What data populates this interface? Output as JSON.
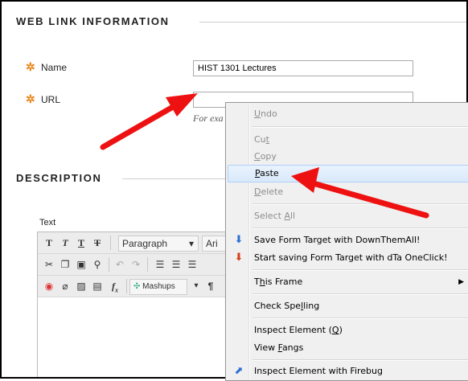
{
  "sections": {
    "web_link_info": "WEB LINK INFORMATION",
    "description": "DESCRIPTION"
  },
  "form": {
    "name_label": "Name",
    "name_value": "HIST 1301 Lectures",
    "url_label": "URL",
    "url_value": "",
    "url_hint": "For exa",
    "text_label": "Text"
  },
  "editor": {
    "paragraph": "Paragraph",
    "font": "Ari",
    "mashups": "Mashups"
  },
  "context_menu": {
    "items": [
      {
        "label_pre": "",
        "mnemonic": "U",
        "label_post": "ndo",
        "enabled": false
      },
      {
        "label_pre": "Cu",
        "mnemonic": "t",
        "label_post": "",
        "enabled": false
      },
      {
        "label_pre": "",
        "mnemonic": "C",
        "label_post": "opy",
        "enabled": false
      },
      {
        "label_pre": "",
        "mnemonic": "P",
        "label_post": "aste",
        "enabled": true,
        "highlighted": true
      },
      {
        "label_pre": "",
        "mnemonic": "D",
        "label_post": "elete",
        "enabled": false
      },
      {
        "label_pre": "Select ",
        "mnemonic": "A",
        "label_post": "ll",
        "enabled": false
      },
      {
        "label": "Save Form Target with DownThemAll!",
        "icon": "downthemall-icon"
      },
      {
        "label": "Start saving Form Target with dTa OneClick!",
        "icon": "dta-oneclick-icon"
      },
      {
        "label_pre": "T",
        "mnemonic": "h",
        "label_post": "is Frame",
        "submenu": true
      },
      {
        "label_pre": "Check Spe",
        "mnemonic": "l",
        "label_post": "ling"
      },
      {
        "label_pre": "Inspect Element (",
        "mnemonic": "Q",
        "label_post": ")"
      },
      {
        "label_pre": "View ",
        "mnemonic": "F",
        "label_post": "angs"
      },
      {
        "label": "Inspect Element with Firebug",
        "icon": "firebug-icon"
      }
    ]
  },
  "colors": {
    "required_star": "#e8871e",
    "arrow": "#ee1111",
    "menu_bg": "#f0f0f0",
    "highlight": "#d8e9fb"
  }
}
